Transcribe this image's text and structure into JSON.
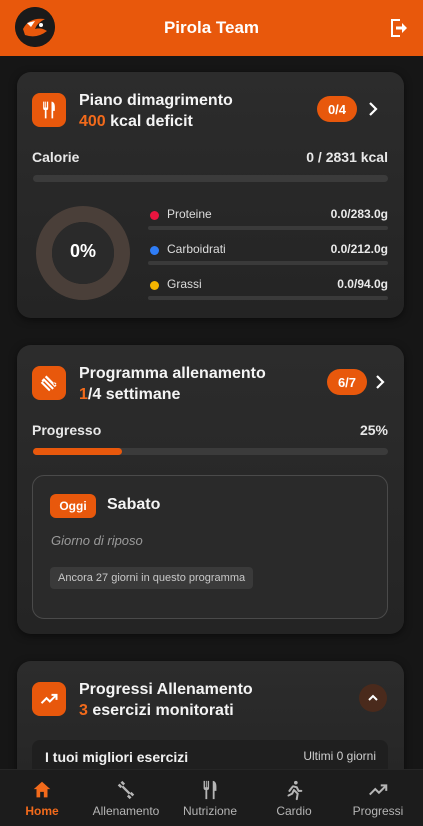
{
  "app": {
    "title": "Pirola Team"
  },
  "colors": {
    "accent": "#e8580c",
    "background": "#161616",
    "card": "#2a2a2a"
  },
  "nutrition": {
    "title": "Piano dimagrimento",
    "deficit_value": "400",
    "deficit_text": " kcal deficit",
    "badge": "0/4",
    "calories_label": "Calorie",
    "calories_value": "0 / 2831 kcal",
    "calories_progress": 0,
    "donut_label": "0%",
    "macros": [
      {
        "name": "Proteine",
        "value": "0.0/283.0g",
        "color": "#e8153f",
        "progress": 0
      },
      {
        "name": "Carboidrati",
        "value": "0.0/212.0g",
        "color": "#2f7df6",
        "progress": 0
      },
      {
        "name": "Grassi",
        "value": "0.0/94.0g",
        "color": "#f5b400",
        "progress": 0
      }
    ]
  },
  "training": {
    "title": "Programma allenamento",
    "week_current": "1",
    "week_text": "/4 settimane",
    "badge": "6/7",
    "progress_label": "Progresso",
    "progress_value": "25%",
    "progress_fraction": 0.25,
    "today_badge": "Oggi",
    "day_name": "Sabato",
    "day_status": "Giorno di riposo",
    "remaining": "Ancora 27 giorni in questo programma"
  },
  "progress": {
    "title": "Progressi Allenamento",
    "count": "3",
    "count_text": " esercizi monitorati",
    "best_title": "I tuoi migliori esercizi",
    "best_range": "Ultimi 0 giorni"
  },
  "nav": [
    {
      "label": "Home",
      "icon": "home-icon",
      "active": true
    },
    {
      "label": "Allenamento",
      "icon": "dumbbell-icon",
      "active": false
    },
    {
      "label": "Nutrizione",
      "icon": "fork-knife-icon",
      "active": false
    },
    {
      "label": "Cardio",
      "icon": "running-icon",
      "active": false
    },
    {
      "label": "Progressi",
      "icon": "trending-up-icon",
      "active": false
    }
  ]
}
